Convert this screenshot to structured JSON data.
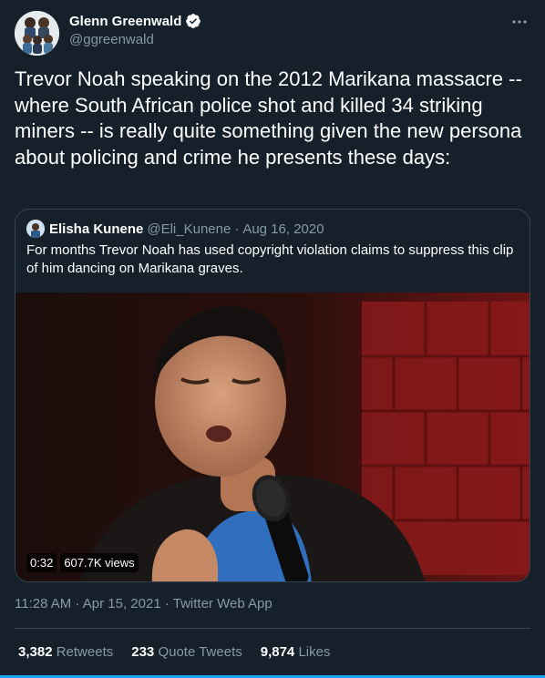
{
  "author": {
    "name": "Glenn Greenwald",
    "handle": "@ggreenwald",
    "verified": true
  },
  "more_icon": "more-horizontal-icon",
  "tweet": {
    "text": "Trevor Noah speaking on the 2012 Marikana massacre -- where South African police shot and killed 34 striking miners -- is really quite something given the new persona about policing and crime he presents these days:"
  },
  "quote": {
    "name": "Elisha Kunene",
    "handle": "@Eli_Kunene",
    "separator": "·",
    "date": "Aug 16, 2020",
    "text": "For months Trevor Noah has used copyright violation claims to suppress this clip of him dancing on Marikana graves.",
    "video": {
      "duration": "0:32",
      "views": "607.7K views"
    }
  },
  "meta": {
    "time": "11:28 AM",
    "sep1": " · ",
    "date": "Apr 15, 2021",
    "sep2": " · ",
    "app": "Twitter Web App"
  },
  "stats": {
    "retweets_num": "3,382",
    "retweets_label": "Retweets",
    "quotes_num": "233",
    "quotes_label": "Quote Tweets",
    "likes_num": "9,874",
    "likes_label": "Likes"
  },
  "colors": {
    "background": "#15202b",
    "secondary_text": "#8899a6",
    "border": "#38444d",
    "verified": "#ffffff",
    "accent": "#1da1f2"
  }
}
